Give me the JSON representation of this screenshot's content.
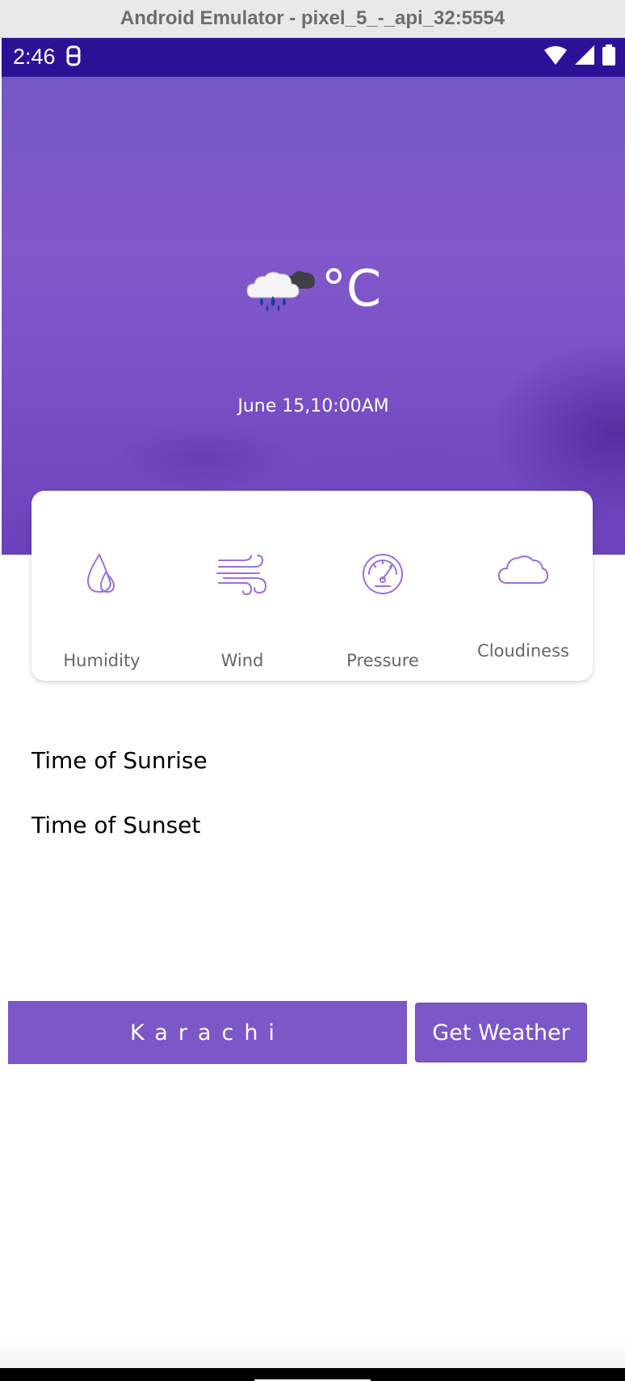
{
  "window": {
    "title": "Android Emulator - pixel_5_-_api_32:5554"
  },
  "status_bar": {
    "time": "2:46"
  },
  "weather": {
    "icon": "rain-cloud-icon",
    "temperature_unit": "°C",
    "datetime": "June 15,10:00AM"
  },
  "metrics": [
    {
      "label": "Humidity",
      "icon": "water-drop-icon"
    },
    {
      "label": "Wind",
      "icon": "wind-icon"
    },
    {
      "label": "Pressure",
      "icon": "gauge-icon"
    },
    {
      "label": "Cloudiness",
      "icon": "cloud-icon"
    }
  ],
  "sun": {
    "sunrise_label": "Time of Sunrise",
    "sunset_label": "Time of Sunset"
  },
  "search": {
    "city_value": "Karachi",
    "button_label": "Get Weather"
  },
  "colors": {
    "accent": "#7c57c8",
    "status_bar": "#2d1298",
    "icon_stroke": "#9b6fe0"
  }
}
